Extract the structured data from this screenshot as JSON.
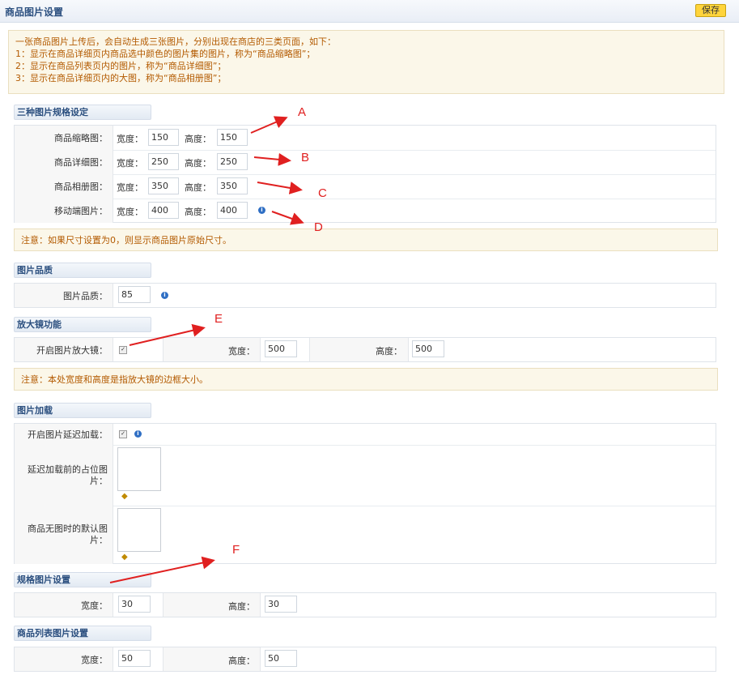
{
  "page": {
    "title": "商品图片设置",
    "save_label": "保存"
  },
  "intro": {
    "lines": [
      "一张商品图片上传后，会自动生成三张图片，分别出现在商店的三类页面，如下：",
      "1：显示在商品详细页内商品选中颜色的图片集的图片，称为“商品缩略图”；",
      "2：显示在商品列表页内的图片，称为“商品详细图”；",
      "3：显示在商品详细页内的大图，称为“商品相册图”；"
    ]
  },
  "specs": {
    "title": "三种图片规格设定",
    "width_label": "宽度：",
    "height_label": "高度：",
    "rows": [
      {
        "label": "商品缩略图：",
        "width": "150",
        "height": "150"
      },
      {
        "label": "商品详细图：",
        "width": "250",
        "height": "250"
      },
      {
        "label": "商品相册图：",
        "width": "350",
        "height": "350"
      },
      {
        "label": "移动端图片：",
        "width": "400",
        "height": "400"
      }
    ],
    "note": "注意：如果尺寸设置为0，则显示商品图片原始尺寸。"
  },
  "quality": {
    "title": "图片品质",
    "label": "图片品质：",
    "value": "85"
  },
  "zoom": {
    "title": "放大镜功能",
    "label": "开启图片放大镜：",
    "width_label": "宽度：",
    "width": "500",
    "height_label": "高度：",
    "height": "500",
    "note": "注意：本处宽度和高度是指放大镜的边框大小。"
  },
  "lazy": {
    "title": "图片加载",
    "enable_label": "开启图片延迟加载：",
    "placeholder_label": "延迟加载前的占位图片：",
    "default_label": "商品无图时的默认图片："
  },
  "spec_img": {
    "title": "规格图片设置",
    "width_label": "宽度：",
    "width": "30",
    "height_label": "高度：",
    "height": "30"
  },
  "list_img": {
    "title": "商品列表图片设置",
    "width_label": "宽度：",
    "width": "50",
    "height_label": "高度：",
    "height": "50"
  },
  "annotations": {
    "a": "A",
    "b": "B",
    "c": "C",
    "d": "D",
    "e": "E",
    "f": "F"
  },
  "colors": {
    "annotation": "#e02020",
    "save_button": "#ffd43b",
    "note_text": "#b35a00",
    "heading": "#2b4f7f"
  }
}
